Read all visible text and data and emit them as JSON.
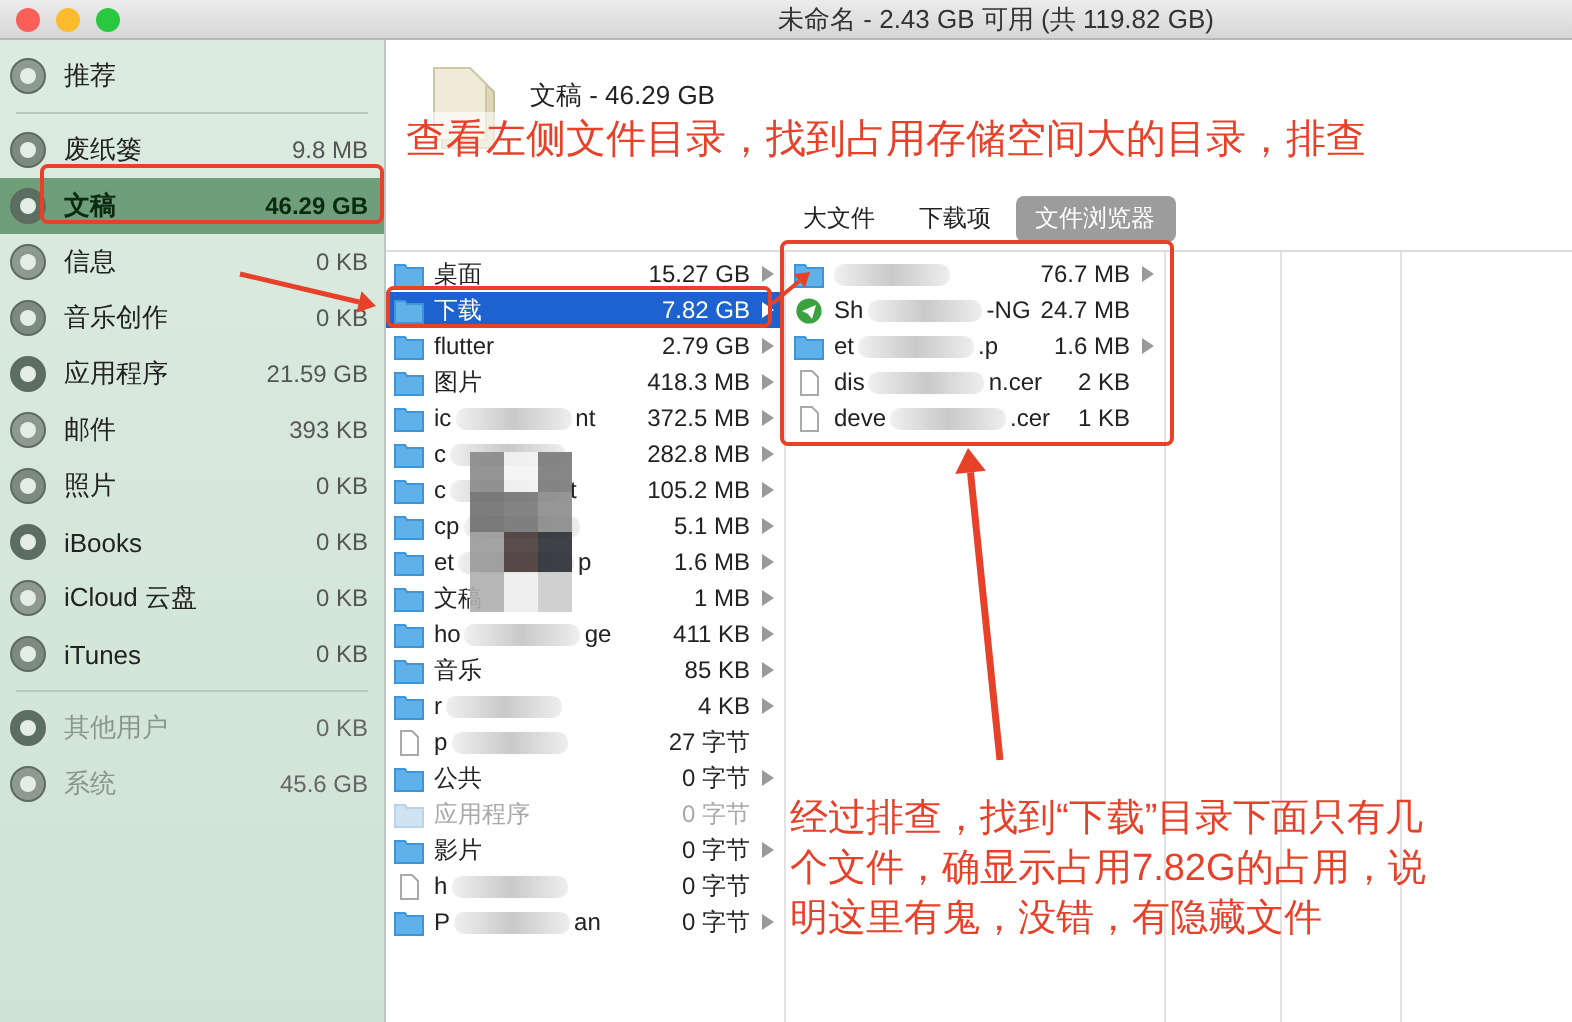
{
  "window": {
    "title": "未命名 - 2.43 GB 可用 (共 119.82 GB)"
  },
  "sidebar": {
    "items": [
      {
        "label": "推荐",
        "selected": false,
        "disabled": false,
        "divider_after": true
      },
      {
        "label": "废纸篓",
        "size": "9.8 MB",
        "selected": false,
        "disabled": false,
        "divider_after": false
      },
      {
        "label": "文稿",
        "size": "46.29 GB",
        "selected": true,
        "disabled": false,
        "divider_after": false
      },
      {
        "label": "信息",
        "size": "0 KB",
        "selected": false,
        "disabled": false,
        "divider_after": false
      },
      {
        "label": "音乐创作",
        "size": "0 KB",
        "selected": false,
        "disabled": false,
        "divider_after": false
      },
      {
        "label": "应用程序",
        "size": "21.59 GB",
        "selected": false,
        "disabled": false,
        "divider_after": false
      },
      {
        "label": "邮件",
        "size": "393 KB",
        "selected": false,
        "disabled": false,
        "divider_after": false
      },
      {
        "label": "照片",
        "size": "0 KB",
        "selected": false,
        "disabled": false,
        "divider_after": false
      },
      {
        "label": "iBooks",
        "size": "0 KB",
        "selected": false,
        "disabled": false,
        "divider_after": false
      },
      {
        "label": "iCloud 云盘",
        "size": "0 KB",
        "selected": false,
        "disabled": false,
        "divider_after": false
      },
      {
        "label": "iTunes",
        "size": "0 KB",
        "selected": false,
        "disabled": false,
        "divider_after": true
      },
      {
        "label": "其他用户",
        "size": "0 KB",
        "selected": false,
        "disabled": true,
        "divider_after": false
      },
      {
        "label": "系统",
        "size": "45.6 GB",
        "selected": false,
        "disabled": true,
        "divider_after": false
      }
    ]
  },
  "header": {
    "title": "文稿 - 46.29 GB"
  },
  "tabs": [
    {
      "label": "大文件",
      "selected": false
    },
    {
      "label": "下载项",
      "selected": false
    },
    {
      "label": "文件浏览器",
      "selected": true
    }
  ],
  "columns": [
    {
      "items": [
        {
          "kind": "folder",
          "name": "桌面",
          "size": "15.27 GB",
          "expandable": true,
          "selected": false,
          "disabled": false,
          "blurred": false
        },
        {
          "kind": "folder",
          "name": "下载",
          "size": "7.82 GB",
          "expandable": true,
          "selected": true,
          "disabled": false,
          "blurred": false
        },
        {
          "kind": "folder",
          "name": "flutter",
          "size": "2.79 GB",
          "expandable": true,
          "selected": false,
          "disabled": false,
          "blurred": false
        },
        {
          "kind": "folder",
          "name": "图片",
          "size": "418.3 MB",
          "expandable": true,
          "selected": false,
          "disabled": false,
          "blurred": false
        },
        {
          "kind": "folder",
          "name": "ic",
          "name_end": "nt",
          "size": "372.5 MB",
          "expandable": true,
          "selected": false,
          "disabled": false,
          "blurred": true
        },
        {
          "kind": "folder",
          "name": "c",
          "size": "282.8 MB",
          "expandable": true,
          "selected": false,
          "disabled": false,
          "blurred": true
        },
        {
          "kind": "folder",
          "name": "c",
          "name_end": "t",
          "size": "105.2 MB",
          "expandable": true,
          "selected": false,
          "disabled": false,
          "blurred": true
        },
        {
          "kind": "folder",
          "name": "cp",
          "size": "5.1 MB",
          "expandable": true,
          "selected": false,
          "disabled": false,
          "blurred": true
        },
        {
          "kind": "folder",
          "name": "et",
          "name_end": "p",
          "size": "1.6 MB",
          "expandable": true,
          "selected": false,
          "disabled": false,
          "blurred": true
        },
        {
          "kind": "folder",
          "name": "文稿",
          "size": "1 MB",
          "expandable": true,
          "selected": false,
          "disabled": false,
          "blurred": false
        },
        {
          "kind": "folder",
          "name": "ho",
          "name_end": "ge",
          "size": "411 KB",
          "expandable": true,
          "selected": false,
          "disabled": false,
          "blurred": true
        },
        {
          "kind": "folder",
          "name": "音乐",
          "size": "85 KB",
          "expandable": true,
          "selected": false,
          "disabled": false,
          "blurred": false
        },
        {
          "kind": "folder",
          "name": "r",
          "size": "4 KB",
          "expandable": true,
          "selected": false,
          "disabled": false,
          "blurred": true
        },
        {
          "kind": "file",
          "name": "p",
          "size": "27 字节",
          "expandable": false,
          "selected": false,
          "disabled": false,
          "blurred": true
        },
        {
          "kind": "folder",
          "name": "公共",
          "size": "0 字节",
          "expandable": true,
          "selected": false,
          "disabled": false,
          "blurred": false
        },
        {
          "kind": "folder",
          "name": "应用程序",
          "size": "0 字节",
          "expandable": false,
          "selected": false,
          "disabled": true,
          "blurred": false
        },
        {
          "kind": "folder",
          "name": "影片",
          "size": "0 字节",
          "expandable": true,
          "selected": false,
          "disabled": false,
          "blurred": false
        },
        {
          "kind": "file",
          "name": "h",
          "size": "0 字节",
          "expandable": false,
          "selected": false,
          "disabled": false,
          "blurred": true
        },
        {
          "kind": "folder",
          "name": "P",
          "name_end": "an",
          "size": "0 字节",
          "expandable": true,
          "selected": false,
          "disabled": false,
          "blurred": true
        }
      ]
    },
    {
      "items": [
        {
          "kind": "folder",
          "size": "76.7 MB",
          "expandable": true,
          "selected": false,
          "disabled": false,
          "blurred": true
        },
        {
          "kind": "app",
          "name": "Sh",
          "name_end": "-NG",
          "size": "24.7 MB",
          "expandable": false,
          "selected": false,
          "disabled": false,
          "blurred": true
        },
        {
          "kind": "folder",
          "name": "et",
          "name_end": ".p",
          "size": "1.6 MB",
          "expandable": true,
          "selected": false,
          "disabled": false,
          "blurred": true
        },
        {
          "kind": "file",
          "name": "dis",
          "name_end": "n.cer",
          "size": "2 KB",
          "expandable": false,
          "selected": false,
          "disabled": false,
          "blurred": true
        },
        {
          "kind": "file",
          "name": "deve",
          "name_end": ".cer",
          "size": "1 KB",
          "expandable": false,
          "selected": false,
          "disabled": false,
          "blurred": true
        }
      ]
    }
  ],
  "annotations": [
    {
      "kind": "banner",
      "text": "查看左侧文件目录，找到占用存储空间大的目录，排查"
    },
    {
      "kind": "note",
      "text": "经过排查，找到“下载”目录下面只有几个文件，确显示占用7.82G的占用，说明这里有鬼，没错，有隐藏文件"
    }
  ]
}
